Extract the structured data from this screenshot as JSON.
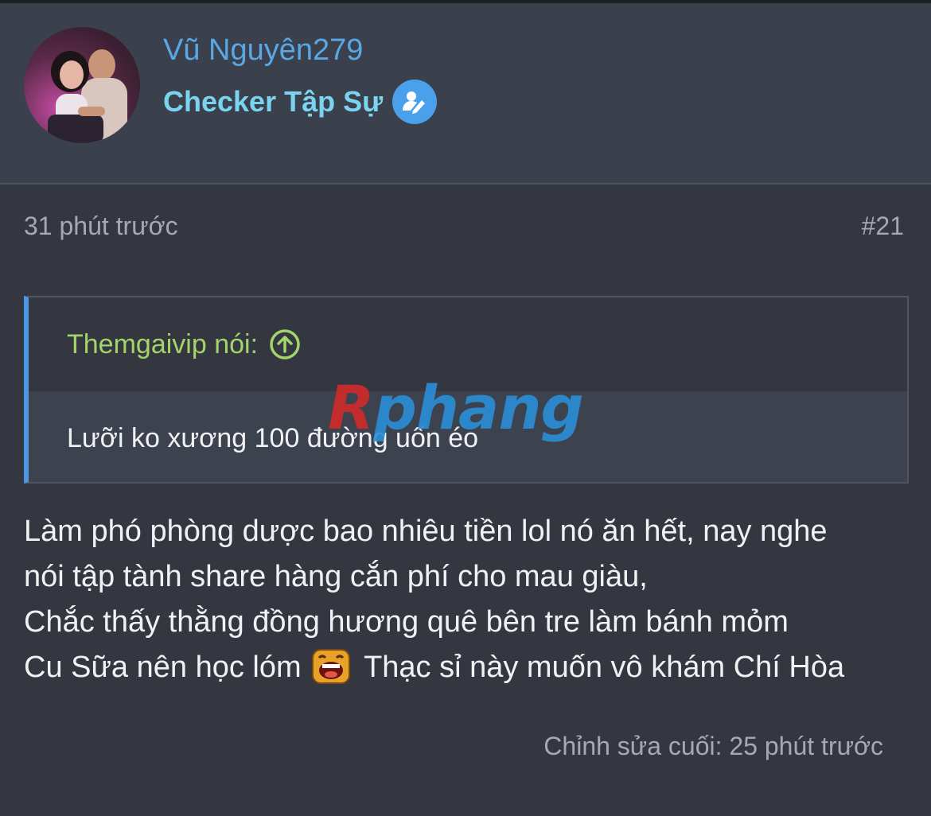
{
  "header": {
    "username": "Vũ Nguyên279",
    "rank": "Checker Tập Sự",
    "rank_badge_icon": "user-edit-icon",
    "avatar_icon": "avatar-photo"
  },
  "meta": {
    "time": "31 phút trước",
    "post_number": "#21"
  },
  "quote": {
    "author": "Themgaivip nói:",
    "jump_icon": "arrow-up-circle-icon",
    "text": "Lưỡi ko xương 100 đường uốn éo"
  },
  "watermark": {
    "first_letter": "R",
    "rest": "phang"
  },
  "post": {
    "line1": "Làm phó phòng dược bao nhiêu tiền lol nó ăn hết, nay nghe",
    "line2": "nói tập tành share hàng cắn phí cho mau giàu,",
    "line3": "Chắc thấy thằng đồng hương quê bên tre làm bánh mỏm",
    "line4_before": "Cu Sữa nên học lóm",
    "emoji_icon": "laughing-emoji-icon",
    "line4_after": "Thạc sỉ này muốn vô khám Chí Hòa"
  },
  "edited": "Chỉnh sửa cuối: 25 phút trước",
  "colors": {
    "background": "#34373f",
    "header_bg": "#3b404d",
    "username": "#5aa7e6",
    "rank": "#7ad3ef",
    "quote_author": "#a3d46c",
    "quote_border": "#4d96e0"
  }
}
